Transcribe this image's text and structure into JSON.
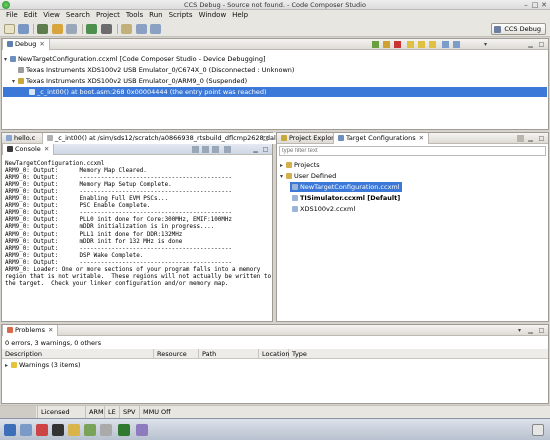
{
  "window": {
    "title": "CCS Debug - Source not found. - Code Composer Studio"
  },
  "menu": [
    "File",
    "Edit",
    "View",
    "Search",
    "Project",
    "Tools",
    "Run",
    "Scripts",
    "Window",
    "Help"
  ],
  "perspective": {
    "label": "CCS Debug"
  },
  "debug_view": {
    "tab": "Debug",
    "rows": [
      "NewTargetConfiguration.ccxml [Code Composer Studio - Device Debugging]",
      "Texas Instruments XDS100v2 USB Emulator_0/C674X_0 (Disconnected : Unknown)",
      "Texas Instruments XDS100v2 USB Emulator_0/ARM9_0 (Suspended)",
      "_c_int00() at boot.asm:268 0x00004444  (the entry point was reached)"
    ]
  },
  "editor": {
    "tabs": [
      "hello.c",
      "_c_int00() at /sim/sds12/scratch/a0866938_rtsbuild_dflcmp2628:dal..."
    ]
  },
  "console": {
    "tab": "Console",
    "config": "NewTargetConfiguration.ccxml",
    "lines": [
      "ARM9_0: Output:      Memory Map Cleared.",
      "ARM9_0: Output:      -------------------------------------------",
      "ARM9_0: Output:      Memory Map Setup Complete.",
      "ARM9_0: Output:      -------------------------------------------",
      "ARM9_0: Output:      Enabling Full EVM PSCs...",
      "ARM9_0: Output:      PSC Enable Complete.",
      "ARM9_0: Output:      -------------------------------------------",
      "ARM9_0: Output:      PLL0 init done for Core:300MHz, EMIF:100MHz",
      "ARM9_0: Output:      mDDR initialization is in progress....",
      "ARM9_0: Output:      PLL1 init done for DDR:132MHz",
      "ARM9_0: Output:      mDDR init for 132 MHz is done",
      "ARM9_0: Output:      -------------------------------------------",
      "ARM9_0: Output:      DSP Wake Complete.",
      "ARM9_0: Output:      -------------------------------------------",
      "ARM9_0: Loader: One or more sections of your program falls into a memory",
      "region that is not writable.  These regions will not actually be written to",
      "the target.  Check your linker configuration and/or memory map."
    ]
  },
  "target_configs": {
    "tabs": [
      "Project Explorer",
      "Target Configurations"
    ],
    "filter_placeholder": "type filter text",
    "tree": {
      "projects": "Projects",
      "user_defined": "User Defined",
      "items": [
        "NewTargetConfiguration.ccxml",
        "TISimulator.ccxml [Default]",
        "XDS100v2.ccxml"
      ]
    }
  },
  "problems": {
    "tab": "Problems",
    "summary": "0 errors, 3 warnings, 0 others",
    "columns": [
      "Description",
      "Resource",
      "Path",
      "Location",
      "Type"
    ],
    "rows": [
      "Warnings (3 items)"
    ]
  },
  "statusbar": [
    "Licensed",
    "ARM",
    "LE",
    "SPV",
    "MMU Off"
  ],
  "colors": {
    "selection": "#3b78d8",
    "chrome": "#e8e6e1"
  }
}
